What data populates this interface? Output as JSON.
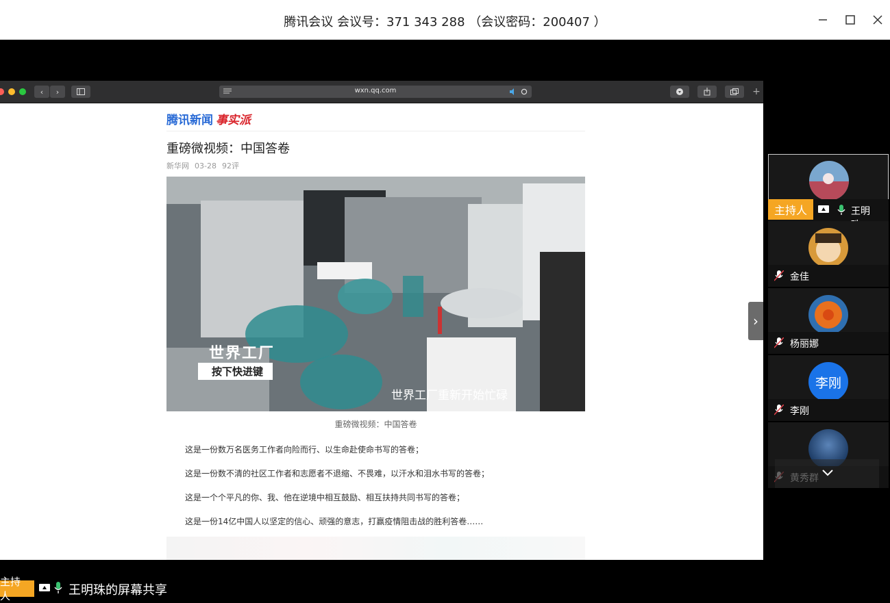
{
  "window": {
    "title": "腾讯会议 会议号：371 343 288 （会议密码：200407 ）",
    "minimize_label": "—",
    "maximize_label": "☐",
    "close_label": "✕"
  },
  "browser": {
    "url": "wxn.qq.com"
  },
  "article": {
    "logo_text": "腾讯新闻",
    "logo_tag": "事实派",
    "headline": "重磅微视频：中国答卷",
    "source": "新华网",
    "date": "03-28",
    "comments": "92评",
    "video_overlay_title": "世界工厂",
    "video_overlay_sub": "按下快进键",
    "video_subtitle": "世界工厂重新开始忙碌",
    "caption": "重磅微视频：中国答卷",
    "paragraphs": [
      "这是一份数万名医务工作者向险而行、以生命赴使命书写的答卷；",
      "这是一份数不清的社区工作者和志愿者不退缩、不畏难，以汗水和泪水书写的答卷；",
      "这是一个个平凡的你、我、他在逆境中相互鼓励、相互扶持共同书写的答卷；",
      "这是一份14亿中国人以坚定的信心、顽强的意志，打赢疫情阻击战的胜利答卷……"
    ]
  },
  "participants": [
    {
      "name": "王明珠...",
      "host_label": "主持人",
      "is_host": true
    },
    {
      "name": "金佳"
    },
    {
      "name": "杨丽娜"
    },
    {
      "name": "李刚",
      "initials": "李刚"
    },
    {
      "name": "黄秀群"
    }
  ],
  "bottom_bar": {
    "host_label": "主持人",
    "share_text": "王明珠的屏幕共享"
  },
  "colors": {
    "accent": "#f5a623",
    "mic_green": "#3ac170",
    "muted_red": "#e0414a",
    "avatar_blue": "#1a73e8"
  }
}
